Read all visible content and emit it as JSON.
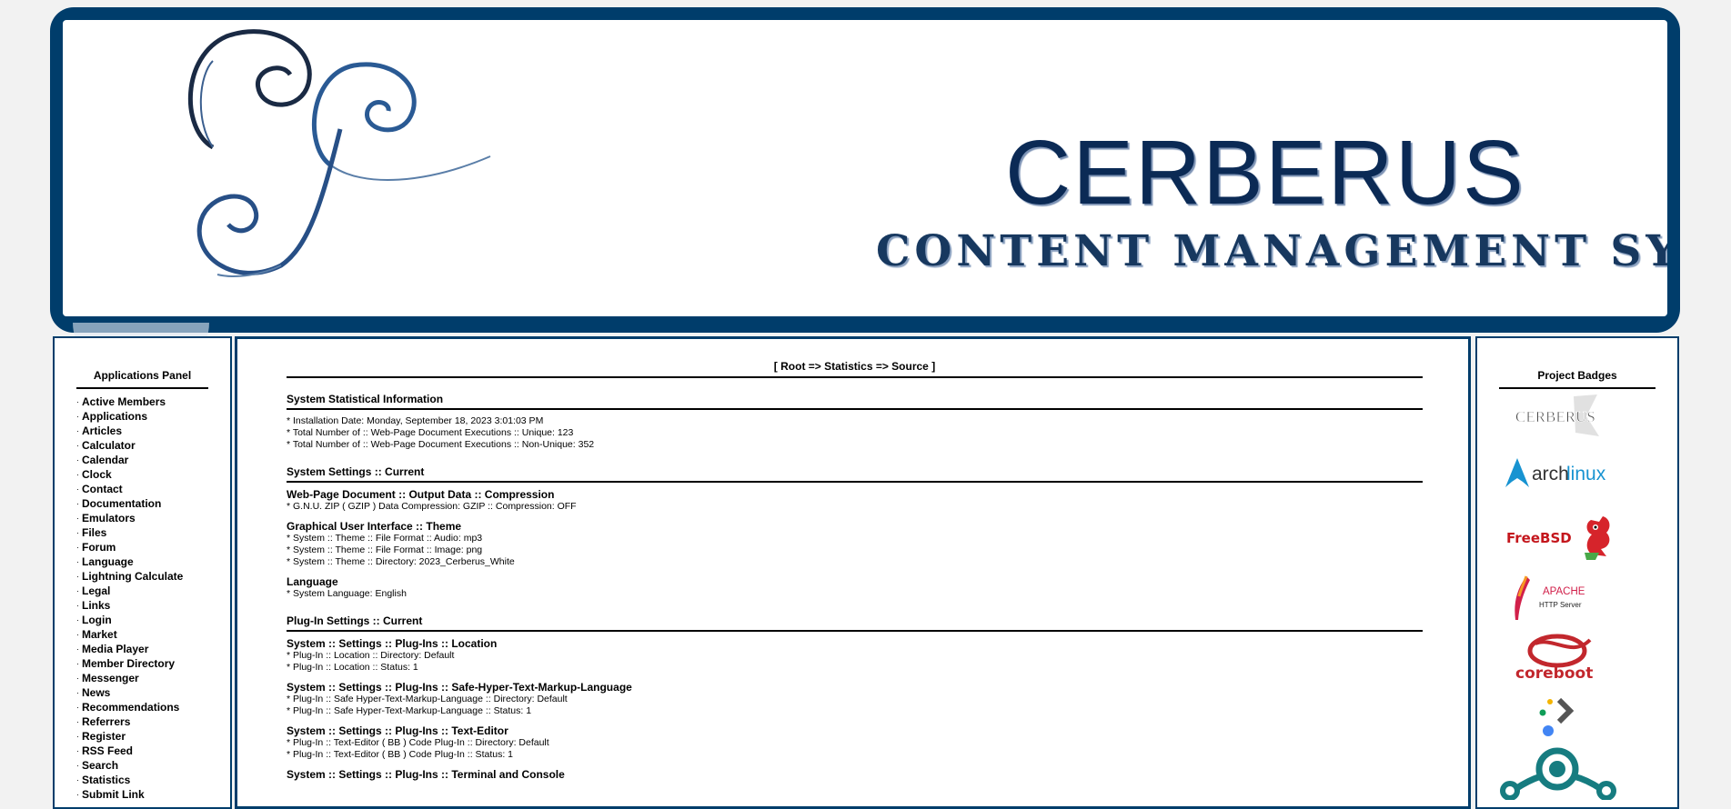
{
  "banner": {
    "title": "CERBERUS",
    "subtitle": "CONTENT MANAGEMENT SYSTEM"
  },
  "applications_panel": {
    "heading": "Applications Panel",
    "items": [
      {
        "label": "Active Members"
      },
      {
        "label": "Applications"
      },
      {
        "label": "Articles"
      },
      {
        "label": "Calculator"
      },
      {
        "label": "Calendar"
      },
      {
        "label": "Clock"
      },
      {
        "label": "Contact"
      },
      {
        "label": "Documentation"
      },
      {
        "label": "Emulators"
      },
      {
        "label": "Files"
      },
      {
        "label": "Forum"
      },
      {
        "label": "Language"
      },
      {
        "label": "Lightning Calculate"
      },
      {
        "label": "Legal"
      },
      {
        "label": "Links"
      },
      {
        "label": "Login"
      },
      {
        "label": "Market"
      },
      {
        "label": "Media Player"
      },
      {
        "label": "Member Directory"
      },
      {
        "label": "Messenger"
      },
      {
        "label": "News"
      },
      {
        "label": "Recommendations"
      },
      {
        "label": "Referrers"
      },
      {
        "label": "Register"
      },
      {
        "label": "RSS Feed"
      },
      {
        "label": "Search"
      },
      {
        "label": "Statistics"
      },
      {
        "label": "Submit Link"
      }
    ]
  },
  "main": {
    "breadcrumb": "[ Root => Statistics => Source ]",
    "statistical": {
      "title": "System Statistical Information",
      "lines": [
        "* Installation Date: Monday, September 18, 2023 3:01:03 PM",
        "* Total Number of :: Web-Page Document Executions :: Unique: 123",
        "* Total Number of :: Web-Page Document Executions :: Non-Unique: 352"
      ]
    },
    "settings": {
      "title": "System Settings :: Current",
      "groups": [
        {
          "title": "Web-Page Document :: Output Data :: Compression",
          "lines": [
            "* G.N.U. ZIP ( GZIP ) Data Compression: GZIP :: Compression: OFF"
          ]
        },
        {
          "title": "Graphical User Interface :: Theme",
          "lines": [
            "* System :: Theme :: File Format :: Audio: mp3",
            "* System :: Theme :: File Format :: Image: png",
            "* System :: Theme :: Directory: 2023_Cerberus_White"
          ]
        },
        {
          "title": "Language",
          "lines": [
            "* System Language: English"
          ]
        }
      ]
    },
    "plugins": {
      "title": "Plug-In Settings :: Current",
      "groups": [
        {
          "title": "System :: Settings :: Plug-Ins :: Location",
          "lines": [
            "* Plug-In :: Location :: Directory: Default",
            "* Plug-In :: Location :: Status: 1"
          ]
        },
        {
          "title": "System :: Settings :: Plug-Ins :: Safe-Hyper-Text-Markup-Language",
          "lines": [
            "* Plug-In :: Safe Hyper-Text-Markup-Language :: Directory: Default",
            "* Plug-In :: Safe Hyper-Text-Markup-Language :: Status: 1"
          ]
        },
        {
          "title": "System :: Settings :: Plug-Ins :: Text-Editor",
          "lines": [
            "* Plug-In :: Text-Editor ( BB ) Code Plug-In :: Directory: Default",
            "* Plug-In :: Text-Editor ( BB ) Code Plug-In :: Status: 1"
          ]
        },
        {
          "title": "System :: Settings :: Plug-Ins :: Terminal and Console",
          "lines": []
        }
      ]
    }
  },
  "badges_panel": {
    "heading": "Project Badges",
    "badges": [
      {
        "name": "cerberus-badge",
        "text": "CERBERUS"
      },
      {
        "name": "archlinux-badge",
        "text_a": "arch",
        "text_b": "linux"
      },
      {
        "name": "freebsd-badge",
        "text": "FreeBSD"
      },
      {
        "name": "apache-badge",
        "text_a": "APACHE",
        "text_b": "HTTP Server"
      },
      {
        "name": "coreboot-badge",
        "text": "coreboot"
      },
      {
        "name": "dart-badge"
      },
      {
        "name": "lineageos-badge"
      }
    ]
  },
  "colors": {
    "banner_frame": "#003d6b",
    "brand_text": "#0b2a55",
    "freebsd_red": "#c4161c",
    "arch_blue": "#1793d1",
    "lineage_teal": "#167c80"
  }
}
